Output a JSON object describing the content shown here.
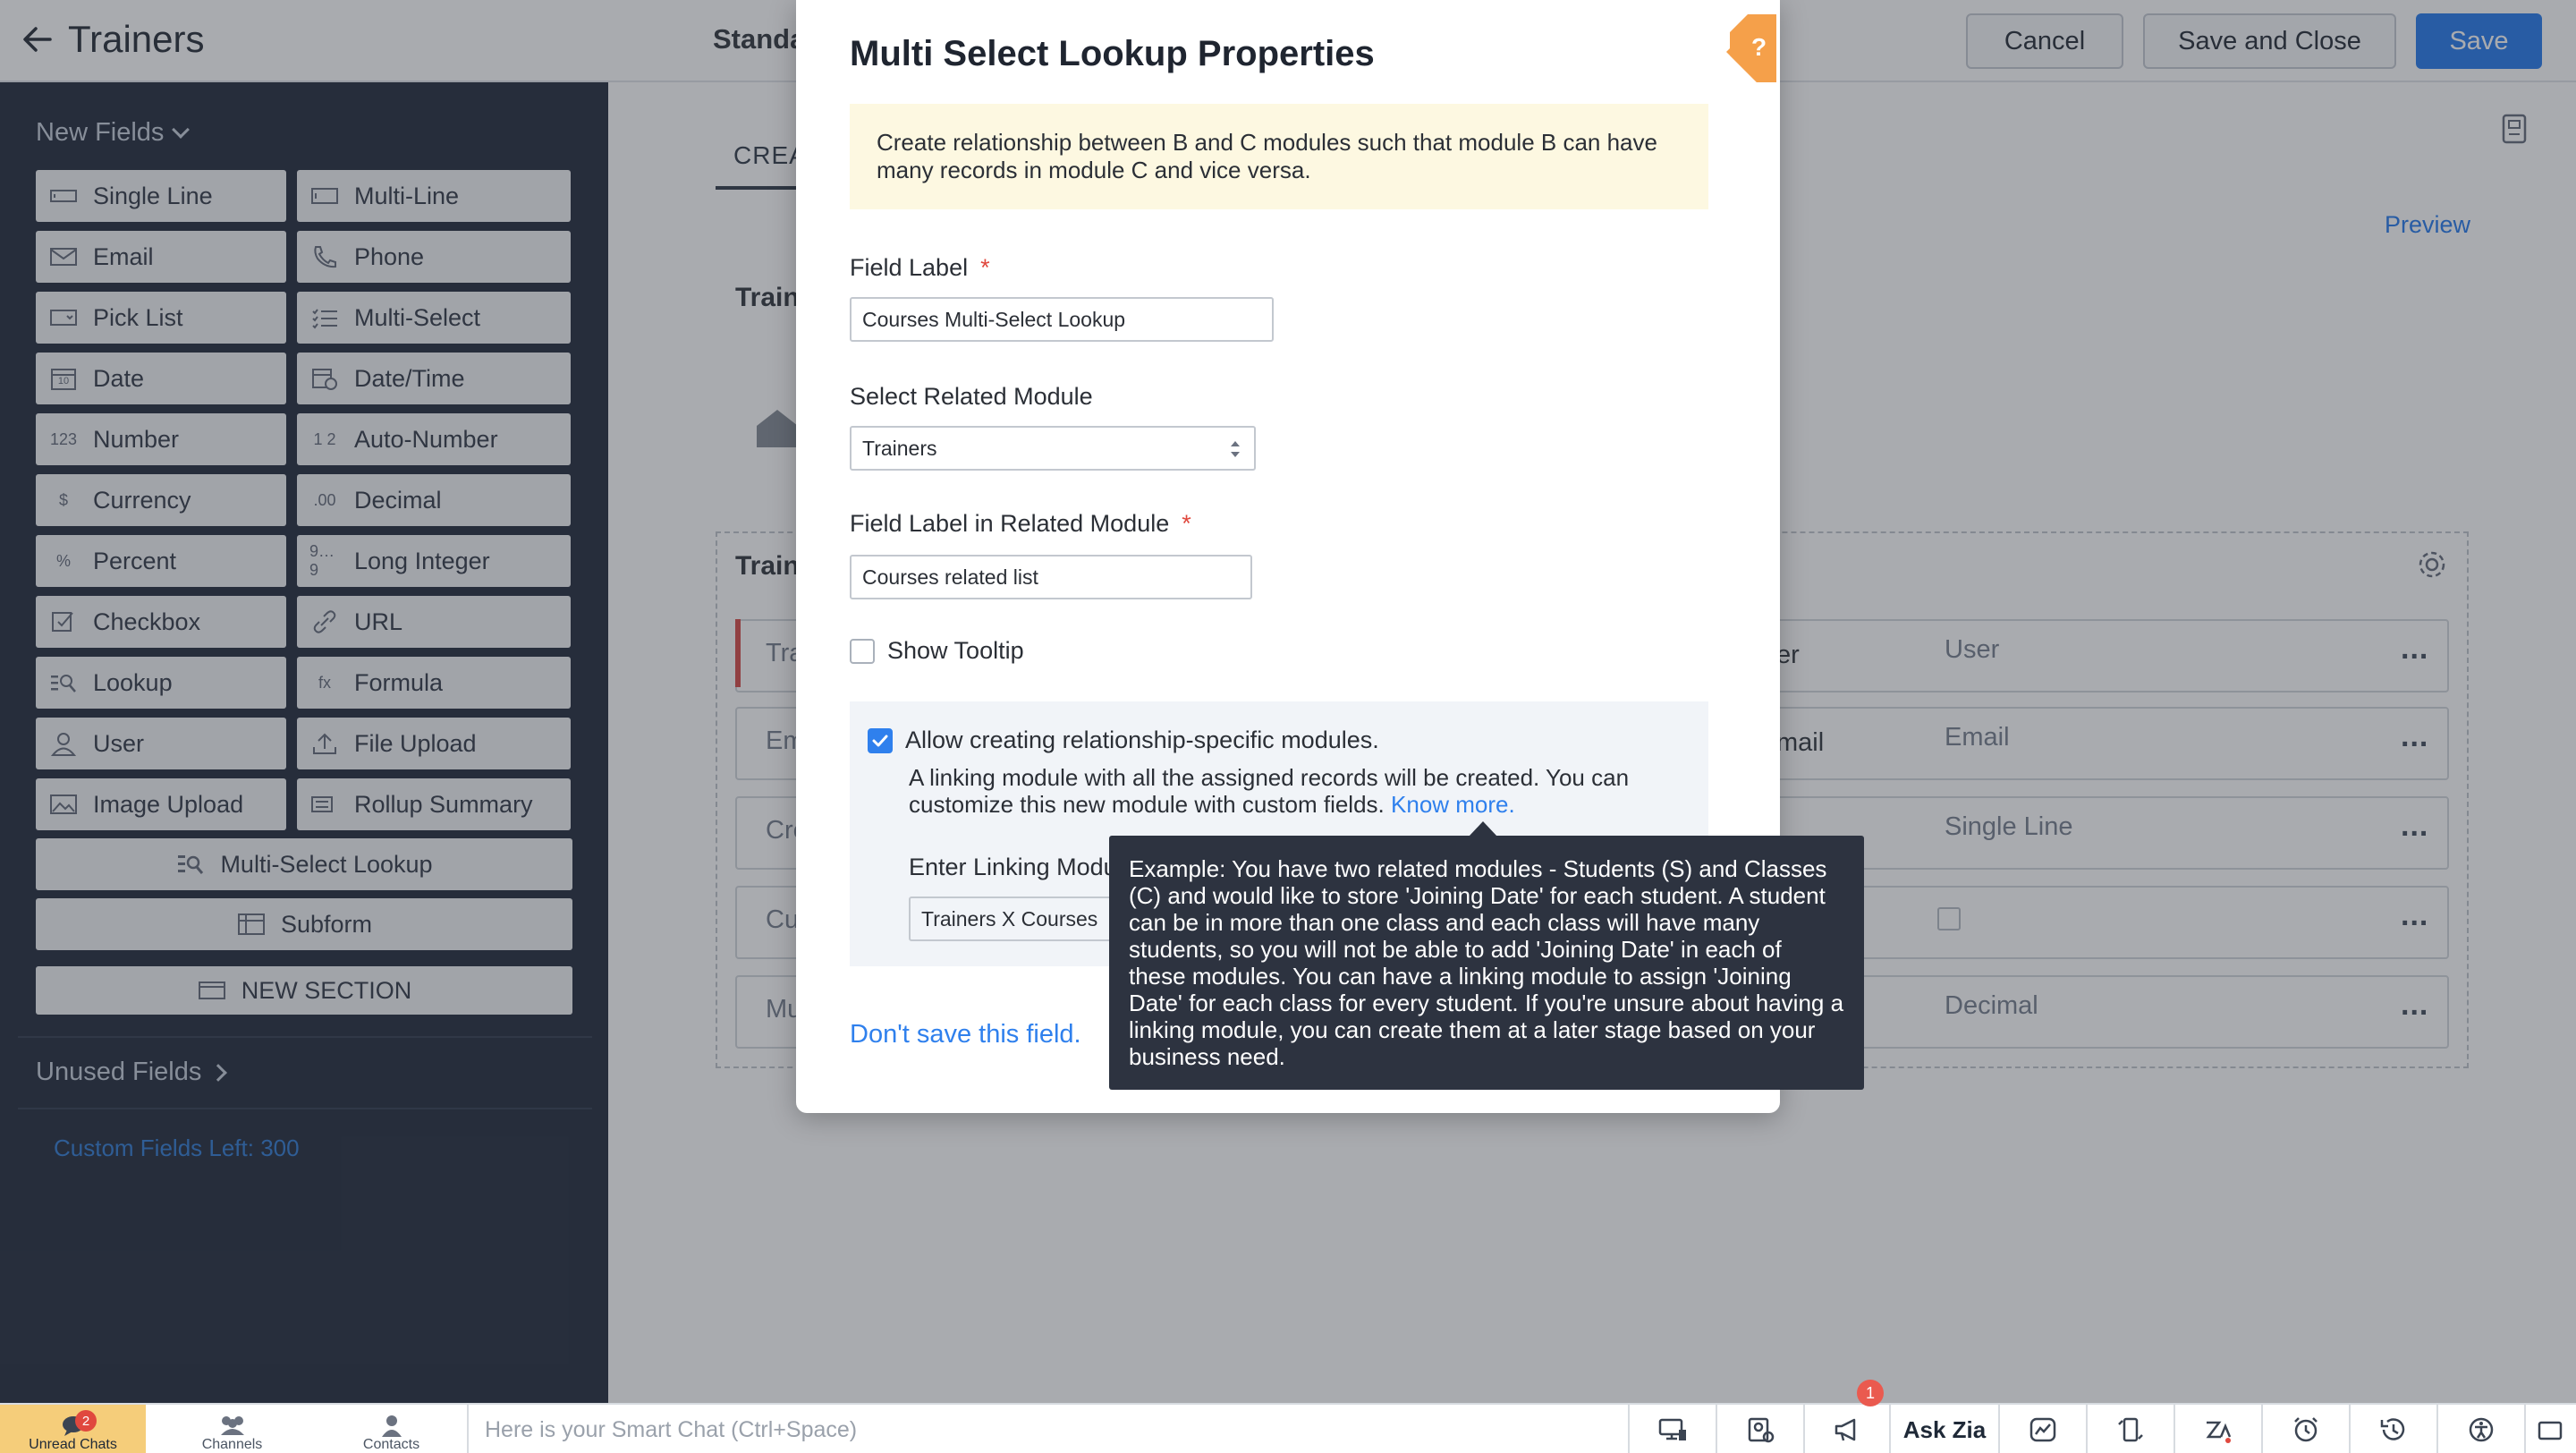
{
  "header": {
    "title": "Trainers",
    "layout_label": "Standa",
    "cancel_label": "Cancel",
    "save_close_label": "Save and Close",
    "save_label": "Save"
  },
  "sidebar": {
    "new_fields_label": "New Fields",
    "fields": [
      {
        "label": "Single Line",
        "icon": "single-line-icon"
      },
      {
        "label": "Multi-Line",
        "icon": "multi-line-icon"
      },
      {
        "label": "Email",
        "icon": "email-icon"
      },
      {
        "label": "Phone",
        "icon": "phone-icon"
      },
      {
        "label": "Pick List",
        "icon": "pick-list-icon"
      },
      {
        "label": "Multi-Select",
        "icon": "multi-select-icon"
      },
      {
        "label": "Date",
        "icon": "calendar-icon",
        "glyph": "10"
      },
      {
        "label": "Date/Time",
        "icon": "date-time-icon"
      },
      {
        "label": "Number",
        "icon": "number-icon",
        "glyph": "123"
      },
      {
        "label": "Auto-Number",
        "icon": "auto-number-icon",
        "glyph": "1 2"
      },
      {
        "label": "Currency",
        "icon": "currency-icon",
        "glyph": "$"
      },
      {
        "label": "Decimal",
        "icon": "decimal-icon",
        "glyph": ".00"
      },
      {
        "label": "Percent",
        "icon": "percent-icon",
        "glyph": "%"
      },
      {
        "label": "Long Integer",
        "icon": "long-integer-icon",
        "glyph": "9…9"
      },
      {
        "label": "Checkbox",
        "icon": "checkbox-icon"
      },
      {
        "label": "URL",
        "icon": "link-icon"
      },
      {
        "label": "Lookup",
        "icon": "lookup-icon"
      },
      {
        "label": "Formula",
        "icon": "formula-icon",
        "glyph": "fx"
      },
      {
        "label": "User",
        "icon": "user-icon"
      },
      {
        "label": "File Upload",
        "icon": "upload-icon"
      },
      {
        "label": "Image Upload",
        "icon": "image-icon"
      },
      {
        "label": "Rollup Summary",
        "icon": "rollup-summary-icon"
      }
    ],
    "multi_select_lookup_label": "Multi-Select Lookup",
    "subform_label": "Subform",
    "new_section_label": "NEW SECTION",
    "unused_fields_label": "Unused Fields",
    "custom_fields_left": "Custom Fields Left: 300"
  },
  "canvas": {
    "tab_label": "CREA",
    "preview_label": "Preview",
    "record_header_label": "Train",
    "section_label": "Train",
    "left_rows": [
      "Tra",
      "Em",
      "Cre",
      "Cu",
      "Mu"
    ],
    "right_rows": [
      {
        "label": "er",
        "type": "User"
      },
      {
        "label": "mail",
        "type": "Email"
      },
      {
        "label": "",
        "type": "Single Line"
      },
      {
        "label": "",
        "type": ""
      },
      {
        "label": "",
        "type": "Decimal"
      }
    ],
    "more_glyph": "..."
  },
  "modal": {
    "title": "Multi Select Lookup Properties",
    "help_glyph": "?",
    "info_text": "Create relationship between B and C modules such that module B can have many records in module C and vice versa.",
    "field_label_label": "Field Label",
    "required_mark": "*",
    "field_label_value": "Courses Multi-Select Lookup",
    "related_module_label": "Select Related Module",
    "related_module_value": "Trainers",
    "related_field_label": "Field Label in Related Module",
    "related_field_value": "Courses related list",
    "show_tooltip_label": "Show Tooltip",
    "show_tooltip_checked": false,
    "allow_relationship_label": "Allow creating relationship-specific modules.",
    "allow_relationship_checked": true,
    "linking_desc": "A linking module with all the assigned records will be created. You can customize this new module with custom fields.",
    "know_more_label": "Know more.",
    "linking_name_label": "Enter Linking Modu",
    "linking_name_value": "Trainers X Courses",
    "dont_save_label": "Don't save this field."
  },
  "tooltip": {
    "text": "Example: You have two related modules - Students (S) and Classes (C) and would like to store 'Joining Date' for each student. A student can be in more than one class and each class will have many students, so you will not be able to add 'Joining Date' in each of these modules. You can have a linking module to assign 'Joining Date' for each class for every student. If you're unsure about having a linking module, you can create them at a later stage based on your business need."
  },
  "bottombar": {
    "unread_chats_label": "Unread Chats",
    "unread_count": "2",
    "channels_label": "Channels",
    "contacts_label": "Contacts",
    "smart_chat_placeholder": "Here is your Smart Chat (Ctrl+Space)",
    "ask_zia_label": "Ask Zia",
    "notification_count": "1"
  },
  "colors": {
    "sidebar_bg": "#2c3445",
    "primary": "#2f80ed",
    "accent_orange": "#f5a04a",
    "tooltip_bg": "#2d3340",
    "info_bg": "#fdf8e1",
    "active_tab": "#f5cd7a"
  }
}
